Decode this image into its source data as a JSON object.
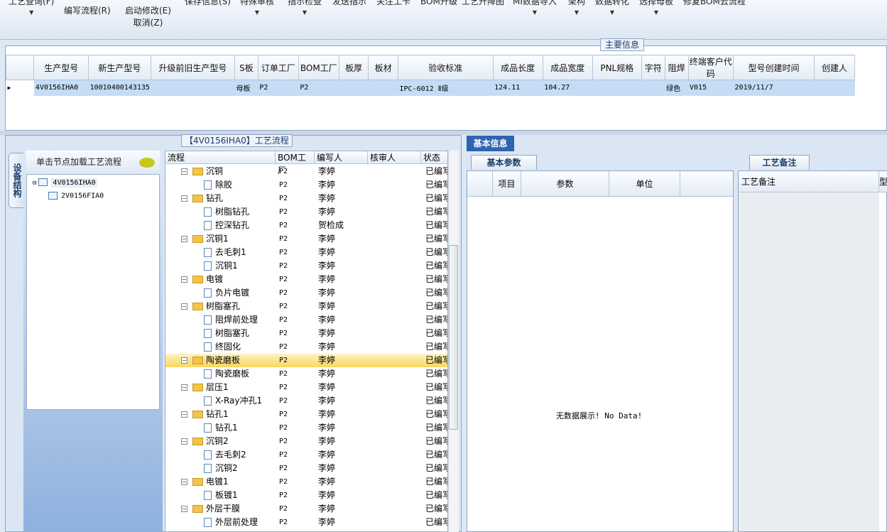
{
  "toolbar": {
    "items": [
      {
        "label": "工艺查询(F)",
        "sub": "",
        "arrow": true
      },
      {
        "label": "编写流程(R)",
        "sub": "",
        "arrow": false
      },
      {
        "label": "启动修改(E)",
        "sub": "取消(Z)",
        "arrow": false
      },
      {
        "label": "保存信息(S)",
        "sub": "",
        "arrow": false
      },
      {
        "label": "特殊审核",
        "sub": "",
        "arrow": true
      },
      {
        "label": "指示检查",
        "sub": "",
        "arrow": true
      },
      {
        "label": "发送指示",
        "sub": "",
        "arrow": false
      },
      {
        "label": "关注工卡",
        "sub": "",
        "arrow": false
      },
      {
        "label": "BOM升级",
        "sub": "",
        "arrow": false
      },
      {
        "label": "工艺升降图",
        "sub": "",
        "arrow": false
      },
      {
        "label": "MI数据导入",
        "sub": "",
        "arrow": true
      },
      {
        "label": "架构",
        "sub": "",
        "arrow": true
      },
      {
        "label": "数据转化",
        "sub": "",
        "arrow": true
      },
      {
        "label": "选择母板",
        "sub": "",
        "arrow": true
      },
      {
        "label": "修复BOM云流程",
        "sub": "",
        "arrow": false
      }
    ]
  },
  "main_info": {
    "title": "主要信息",
    "columns": [
      "生产型号",
      "新生产型号",
      "升级前旧生产型号",
      "S板",
      "订单工厂",
      "BOM工厂",
      "板厚",
      "板材",
      "验收标准",
      "成品长度",
      "成品宽度",
      "PNL规格",
      "字符",
      "阻焊",
      "终端客户代码",
      "型号创建时间",
      "创建人"
    ],
    "row": [
      "4V0156IHA0",
      "10010400143135",
      "",
      "母板",
      "P2",
      "P2",
      "",
      "",
      "IPC-6012 Ⅱ级",
      "124.11",
      "104.27",
      "",
      "",
      "绿色",
      "V015",
      "2019/11/7",
      ""
    ]
  },
  "process_panel": {
    "title": "【4V0156IHA0】工艺流程",
    "side_tab": "设备结构",
    "tree_header": "单击节点加载工艺流程",
    "tree_nodes": [
      "4V0156IHA0",
      "2V0156FIA0"
    ],
    "columns": [
      "流程",
      "BOM工厂",
      "编写人",
      "核审人",
      "状态"
    ],
    "rows": [
      {
        "name": "沉铜",
        "type": "folder",
        "factory": "P2",
        "author": "李婷",
        "reviewer": "",
        "status": "已编写"
      },
      {
        "name": "除胶",
        "type": "doc",
        "factory": "P2",
        "author": "李婷",
        "reviewer": "",
        "status": "已编写"
      },
      {
        "name": "钻孔",
        "type": "folder",
        "factory": "P2",
        "author": "李婷",
        "reviewer": "",
        "status": "已编写"
      },
      {
        "name": "树脂钻孔",
        "type": "doc",
        "factory": "P2",
        "author": "李婷",
        "reviewer": "",
        "status": "已编写"
      },
      {
        "name": "控深钻孔",
        "type": "doc",
        "factory": "P2",
        "author": "贺检成",
        "reviewer": "",
        "status": "已编写"
      },
      {
        "name": "沉铜1",
        "type": "folder",
        "factory": "P2",
        "author": "李婷",
        "reviewer": "",
        "status": "已编写"
      },
      {
        "name": "去毛刺1",
        "type": "doc",
        "factory": "P2",
        "author": "李婷",
        "reviewer": "",
        "status": "已编写"
      },
      {
        "name": "沉铜1",
        "type": "doc",
        "factory": "P2",
        "author": "李婷",
        "reviewer": "",
        "status": "已编写"
      },
      {
        "name": "电镀",
        "type": "folder",
        "factory": "P2",
        "author": "李婷",
        "reviewer": "",
        "status": "已编写"
      },
      {
        "name": "负片电镀",
        "type": "doc",
        "factory": "P2",
        "author": "李婷",
        "reviewer": "",
        "status": "已编写"
      },
      {
        "name": "树脂塞孔",
        "type": "folder",
        "factory": "P2",
        "author": "李婷",
        "reviewer": "",
        "status": "已编写"
      },
      {
        "name": "阻焊前处理",
        "type": "doc",
        "factory": "P2",
        "author": "李婷",
        "reviewer": "",
        "status": "已编写"
      },
      {
        "name": "树脂塞孔",
        "type": "doc",
        "factory": "P2",
        "author": "李婷",
        "reviewer": "",
        "status": "已编写"
      },
      {
        "name": "终固化",
        "type": "doc",
        "factory": "P2",
        "author": "李婷",
        "reviewer": "",
        "status": "已编写"
      },
      {
        "name": "陶瓷磨板",
        "type": "folder",
        "factory": "P2",
        "author": "李婷",
        "reviewer": "",
        "status": "已编写",
        "selected": true
      },
      {
        "name": "陶瓷磨板",
        "type": "doc",
        "factory": "P2",
        "author": "李婷",
        "reviewer": "",
        "status": "已编写"
      },
      {
        "name": "层压1",
        "type": "folder",
        "factory": "P2",
        "author": "李婷",
        "reviewer": "",
        "status": "已编写"
      },
      {
        "name": "X-Ray冲孔1",
        "type": "doc",
        "factory": "P2",
        "author": "李婷",
        "reviewer": "",
        "status": "已编写"
      },
      {
        "name": "钻孔1",
        "type": "folder",
        "factory": "P2",
        "author": "李婷",
        "reviewer": "",
        "status": "已编写"
      },
      {
        "name": "钻孔1",
        "type": "doc",
        "factory": "P2",
        "author": "李婷",
        "reviewer": "",
        "status": "已编写"
      },
      {
        "name": "沉铜2",
        "type": "folder",
        "factory": "P2",
        "author": "李婷",
        "reviewer": "",
        "status": "已编写"
      },
      {
        "name": "去毛刺2",
        "type": "doc",
        "factory": "P2",
        "author": "李婷",
        "reviewer": "",
        "status": "已编写"
      },
      {
        "name": "沉铜2",
        "type": "doc",
        "factory": "P2",
        "author": "李婷",
        "reviewer": "",
        "status": "已编写"
      },
      {
        "name": "电镀1",
        "type": "folder",
        "factory": "P2",
        "author": "李婷",
        "reviewer": "",
        "status": "已编写"
      },
      {
        "name": "板镀1",
        "type": "doc",
        "factory": "P2",
        "author": "李婷",
        "reviewer": "",
        "status": "已编写"
      },
      {
        "name": "外层干膜",
        "type": "folder",
        "factory": "P2",
        "author": "李婷",
        "reviewer": "",
        "status": "已编写"
      },
      {
        "name": "外层前处理",
        "type": "doc",
        "factory": "P2",
        "author": "李婷",
        "reviewer": "",
        "status": "已编写"
      }
    ]
  },
  "basic_info": {
    "tab": "基本信息",
    "params_tab": "基本参数",
    "params_columns": [
      "项目",
      "参数",
      "单位"
    ],
    "no_data": "无数据展示! No Data!",
    "notes_tab": "工艺备注",
    "notes_column": "工艺备注",
    "notes_column2": "型"
  },
  "colors": {
    "selection": "#c5dcf5",
    "accent": "#2e64b0",
    "highlight": "#f8d65f"
  }
}
